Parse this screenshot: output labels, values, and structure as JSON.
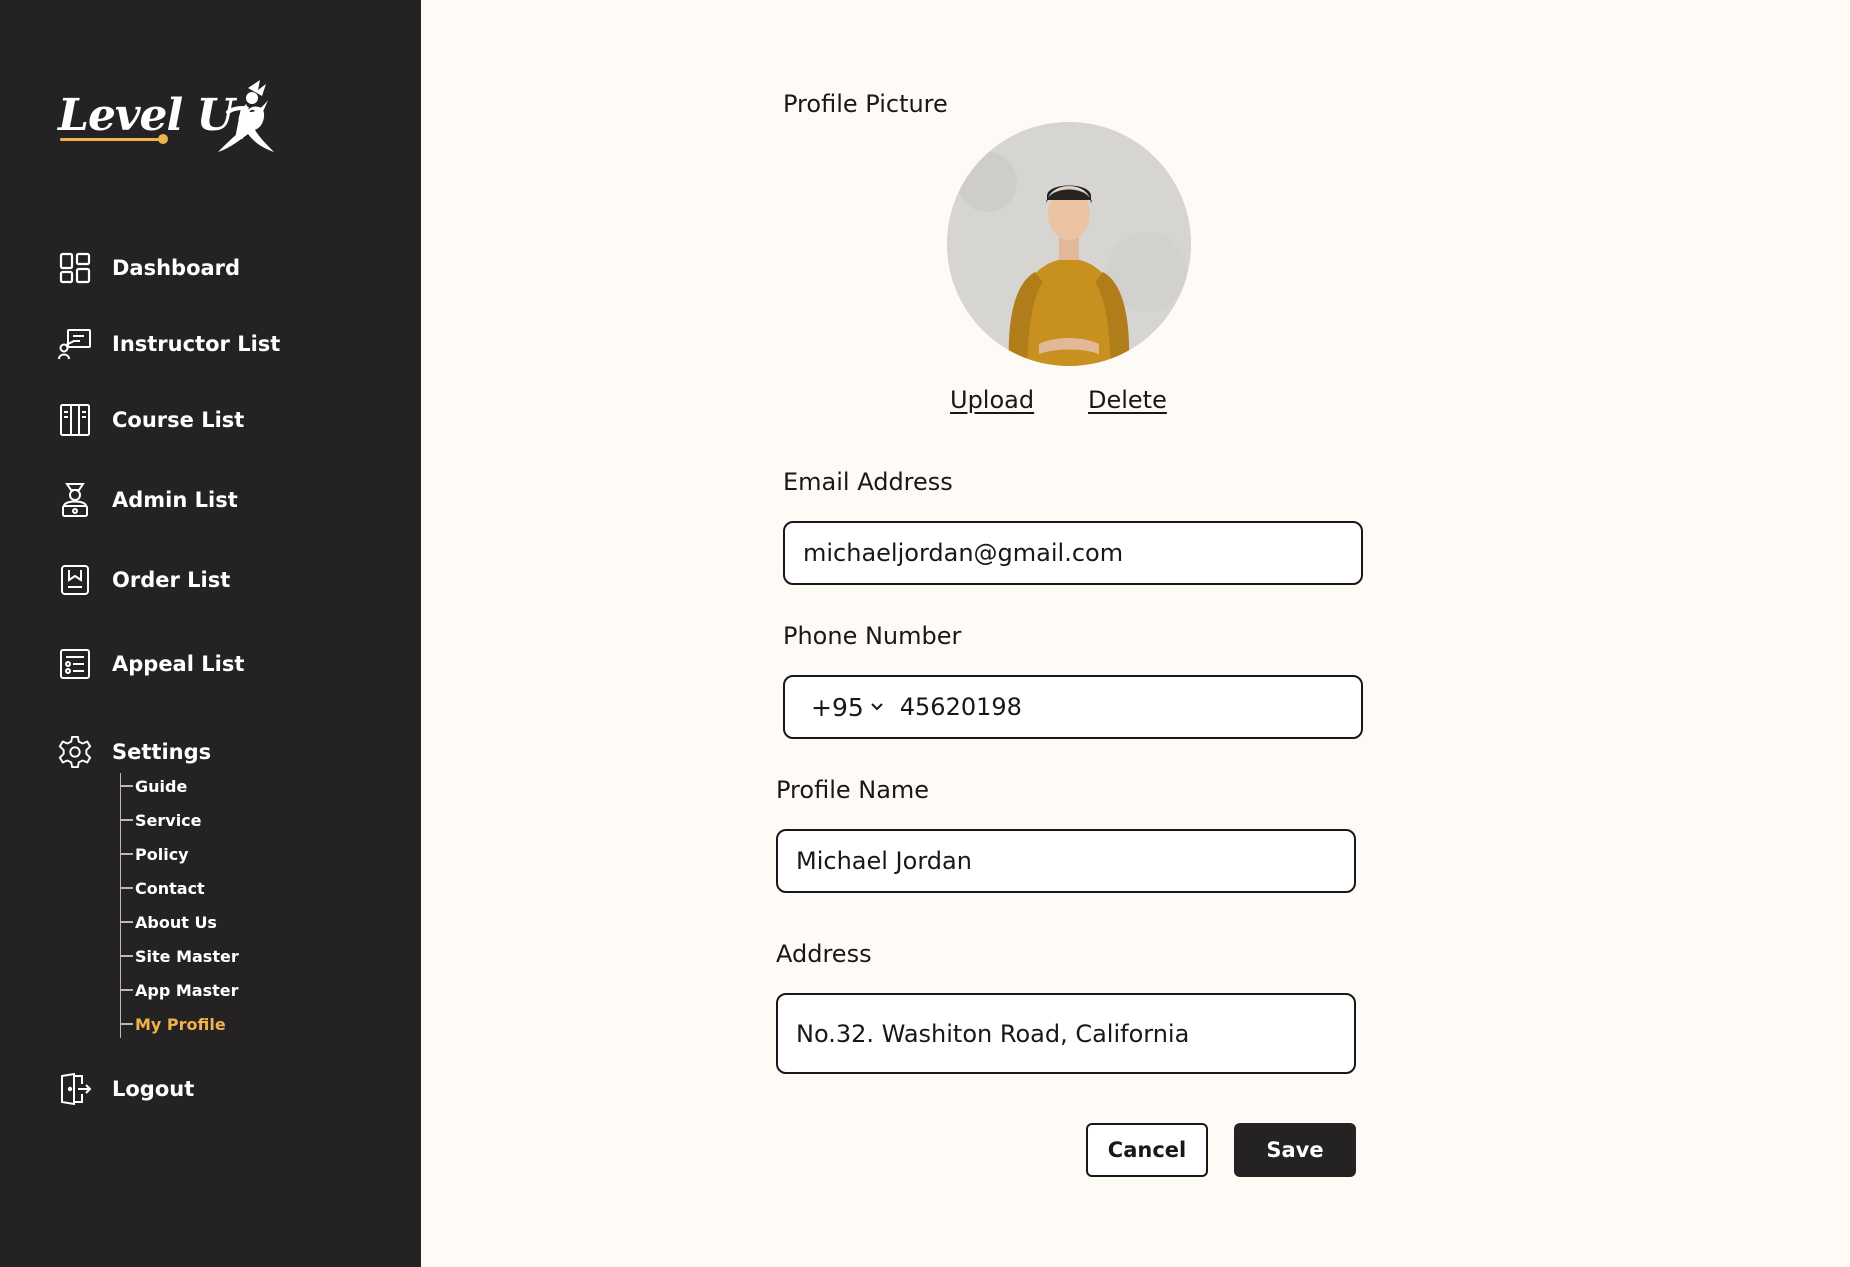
{
  "app": {
    "logo_text": "Level Up",
    "accent_color": "#f0b24a",
    "sidebar_bg": "#252223"
  },
  "sidebar": {
    "items": [
      {
        "label": "Dashboard",
        "icon": "dashboard-grid-icon"
      },
      {
        "label": "Instructor List",
        "icon": "instructor-board-icon"
      },
      {
        "label": "Course List",
        "icon": "book-list-icon"
      },
      {
        "label": "Admin List",
        "icon": "admin-person-icon"
      },
      {
        "label": "Order List",
        "icon": "order-bookmark-icon"
      },
      {
        "label": "Appeal List",
        "icon": "appeal-list-icon"
      },
      {
        "label": "Settings",
        "icon": "gear-icon"
      }
    ],
    "settings_sub": [
      {
        "label": "Guide"
      },
      {
        "label": "Service"
      },
      {
        "label": "Policy"
      },
      {
        "label": "Contact"
      },
      {
        "label": "About Us"
      },
      {
        "label": "Site Master"
      },
      {
        "label": "App Master"
      },
      {
        "label": "My Profile",
        "active": true
      }
    ],
    "logout": {
      "label": "Logout",
      "icon": "logout-door-icon"
    }
  },
  "profile": {
    "picture_label": "Profile Picture",
    "upload_label": "Upload",
    "delete_label": "Delete",
    "email_label": "Email Address",
    "email_value": "michaeljordan@gmail.com",
    "phone_label": "Phone Number",
    "country_code": "+95",
    "phone_value": "45620198",
    "name_label": "Profile Name",
    "name_value": "Michael Jordan",
    "address_label": "Address",
    "address_value": "No.32. Washiton Road, California"
  },
  "actions": {
    "cancel_label": "Cancel",
    "save_label": "Save"
  }
}
